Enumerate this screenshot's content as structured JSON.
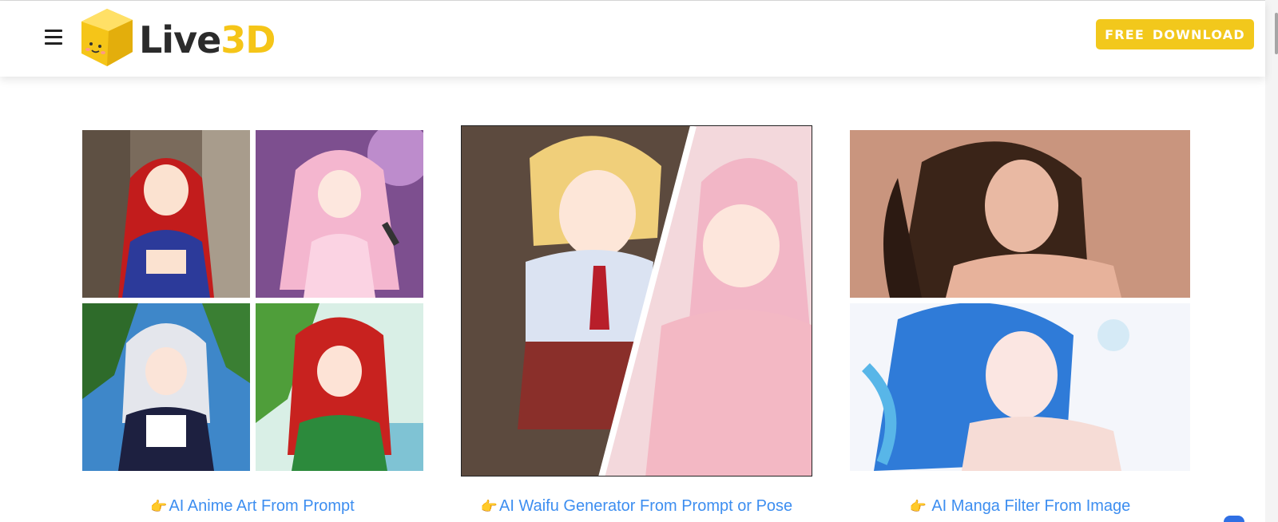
{
  "header": {
    "menu_icon": "hamburger-icon",
    "logo": {
      "text_main": "Live",
      "text_accent": "3D",
      "mascot_icon": "yellow-cube-mascot"
    },
    "download_button": "FREE DOWNLOAD"
  },
  "colors": {
    "brand_yellow": "#f2c81c",
    "link_blue": "#3d8ef0",
    "logo_text": "#2b2b2b"
  },
  "features": [
    {
      "caption": "AI Anime Art From Prompt",
      "icon": "pointing-hand-emoji",
      "image": "grid of four anime character illustrations"
    },
    {
      "caption": "AI Waifu Generator From Prompt or Pose",
      "icon": "pointing-hand-emoji",
      "image": "two anime girls split diagonally"
    },
    {
      "caption": "AI Manga Filter From Image",
      "icon": "pointing-hand-emoji",
      "image": "photo of woman and anime-filtered version"
    }
  ]
}
